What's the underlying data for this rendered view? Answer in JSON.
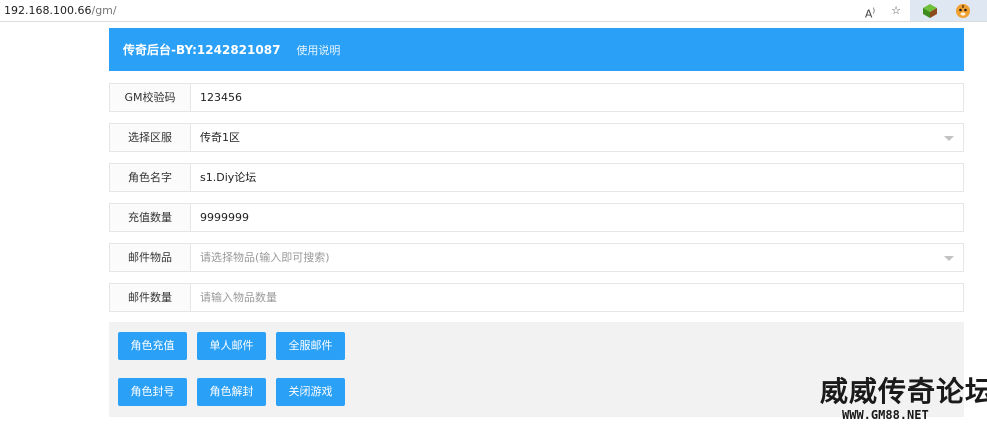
{
  "browser": {
    "url_host": "192.168.100.66",
    "url_path": "/gm/",
    "read_aloud_icon": "read-aloud-icon",
    "favorites_icon": "add-favorite-icon"
  },
  "header": {
    "title": "传奇后台-BY:1242821087",
    "help_link": "使用说明"
  },
  "form": {
    "gm_code": {
      "label": "GM校验码",
      "value": "123456"
    },
    "server": {
      "label": "选择区服",
      "value": "传奇1区"
    },
    "role_name": {
      "label": "角色名字",
      "value": "s1.Diy论坛"
    },
    "recharge_amount": {
      "label": "充值数量",
      "value": "9999999"
    },
    "mail_item": {
      "label": "邮件物品",
      "placeholder": "请选择物品(输入即可搜索)"
    },
    "mail_quantity": {
      "label": "邮件数量",
      "placeholder": "请输入物品数量"
    }
  },
  "buttons": {
    "row1": [
      "角色充值",
      "单人邮件",
      "全服邮件"
    ],
    "row2": [
      "角色封号",
      "角色解封",
      "关闭游戏"
    ]
  },
  "watermark": {
    "text": "威威传奇论坛",
    "domain": "WWW.GM88.NET"
  },
  "colors": {
    "accent": "#2aa0f7",
    "panel": "#f2f2f2",
    "border": "#e6e6e6"
  }
}
